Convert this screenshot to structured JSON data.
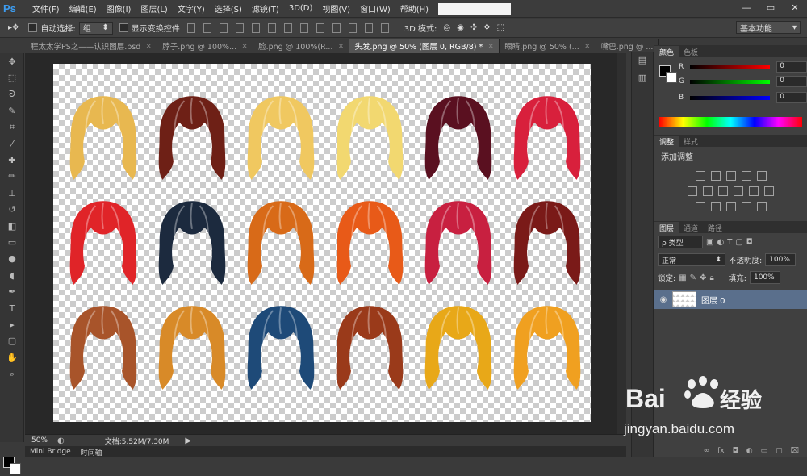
{
  "app": {
    "logo": "Ps"
  },
  "menu": [
    "文件(F)",
    "编辑(E)",
    "图像(I)",
    "图层(L)",
    "文字(Y)",
    "选择(S)",
    "滤镜(T)",
    "3D(D)",
    "视图(V)",
    "窗口(W)",
    "帮助(H)"
  ],
  "window_controls": [
    "—",
    "▭",
    "✕"
  ],
  "options": {
    "auto_select_label": "自动选择:",
    "auto_select_value": "组",
    "show_transform_label": "显示变换控件",
    "mode3d_label": "3D 模式:",
    "workspace": "基本功能"
  },
  "tabs": [
    {
      "label": "程太太学PS之——认识图层.psd",
      "active": false
    },
    {
      "label": "脖子.png @ 100%...",
      "active": false
    },
    {
      "label": "脸.png @ 100%(R...",
      "active": false
    },
    {
      "label": "头发.png @ 50% (图层 0, RGB/8) *",
      "active": true
    },
    {
      "label": "眼睛.png @ 50% (...",
      "active": false
    },
    {
      "label": "嘴巴.png @ ...",
      "active": false
    }
  ],
  "tab_more": "»",
  "status": {
    "zoom": "50%",
    "doc": "文档:5.52M/7.30M"
  },
  "bottom_tabs": [
    "Mini Bridge",
    "时间轴"
  ],
  "color_panel": {
    "tabs": [
      "颜色",
      "色板"
    ],
    "channels": [
      {
        "label": "R",
        "value": "0"
      },
      {
        "label": "G",
        "value": "0"
      },
      {
        "label": "B",
        "value": "0"
      }
    ]
  },
  "adjust_panel": {
    "tabs": [
      "调整",
      "样式"
    ],
    "title": "添加调整"
  },
  "layers_panel": {
    "tabs": [
      "图层",
      "通道",
      "路径"
    ],
    "kind": "ρ 类型",
    "blend_mode": "正常",
    "opacity_label": "不透明度:",
    "opacity_value": "100%",
    "lock_label": "锁定:",
    "fill_label": "填充:",
    "fill_value": "100%",
    "layer_name": "图层 0"
  },
  "watermark": {
    "brand_left": "Bai",
    "brand_cn": "经验",
    "url": "jingyan.baidu.com"
  },
  "hair_colors": [
    "#e8b850",
    "#6e2016",
    "#f0c860",
    "#f2d870",
    "#5a1020",
    "#d8203c",
    "#e02428",
    "#1c2a3e",
    "#d86a18",
    "#e85a18",
    "#c82040",
    "#7a1a18",
    "#a8542a",
    "#d88a28",
    "#1e4a78",
    "#9a3a1a",
    "#e8a818",
    "#f0a020"
  ]
}
